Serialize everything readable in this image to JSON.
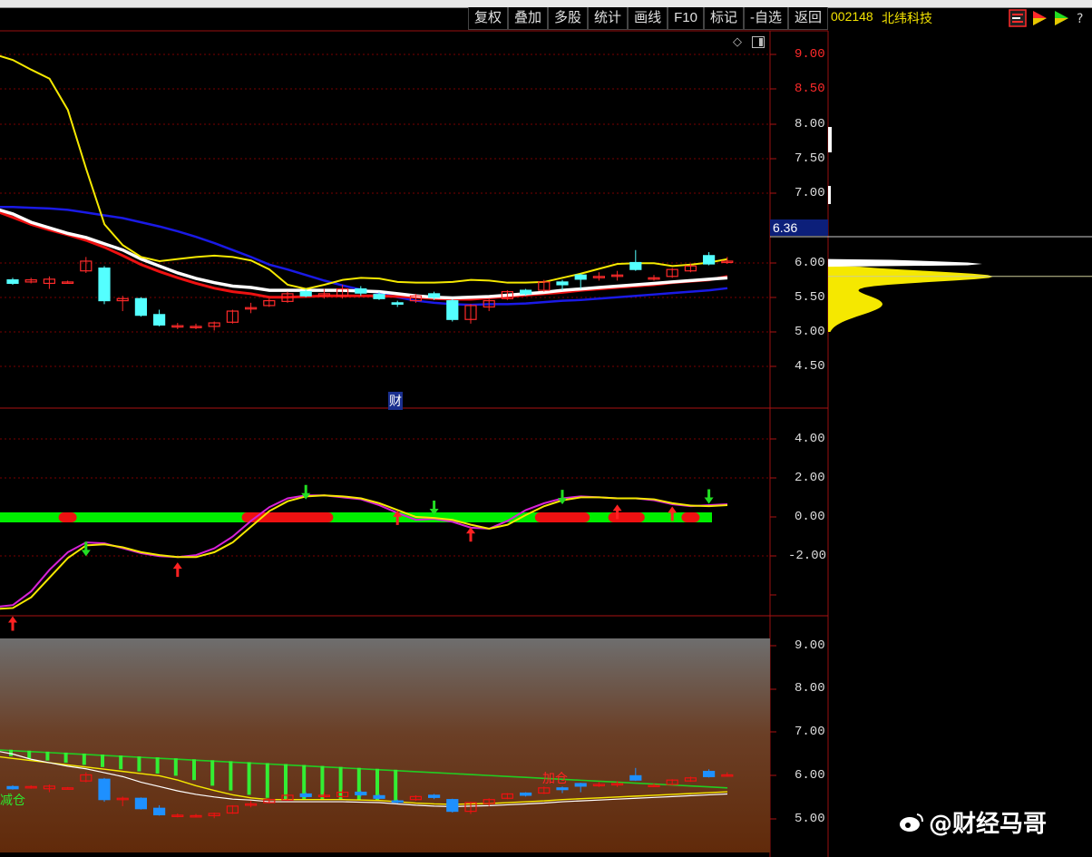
{
  "toolbar": {
    "buttons": [
      "复权",
      "叠加",
      "多股",
      "统计",
      "画线",
      "F10",
      "标记",
      "-自选",
      "返回"
    ]
  },
  "stock": {
    "code": "002148",
    "name": "北纬科技"
  },
  "main_panel": {
    "current_price": "6.36",
    "finance_marker": "财",
    "y_ticks": [
      "9.00",
      "8.50",
      "8.00",
      "7.50",
      "7.00",
      "6.00",
      "5.50",
      "5.00",
      "4.50"
    ]
  },
  "osc_panel": {
    "y_ticks": [
      "4.00",
      "2.00",
      "0.00",
      "-2.00"
    ]
  },
  "lower_panel": {
    "y_ticks": [
      "9.00",
      "8.00",
      "7.00",
      "6.00",
      "5.00"
    ],
    "signal_add": "加仓",
    "signal_reduce": "减仓"
  },
  "watermark": {
    "text": "@财经马哥"
  },
  "colors": {
    "up": "#ff2a2a",
    "down": "#54ffff",
    "ma_white": "#ffffff",
    "ma_yellow": "#f5e800",
    "ma_red": "#ee1111",
    "ma_blue": "#1a1ae6",
    "zero_band": "#00ee00",
    "grid": "#7a0000"
  },
  "chart_data": [
    {
      "type": "candlestick",
      "title": "",
      "ylim": [
        4.2,
        9.2
      ],
      "candles": [
        {
          "o": 5.75,
          "c": 5.7,
          "h": 5.78,
          "l": 5.68
        },
        {
          "o": 5.72,
          "c": 5.75,
          "h": 5.78,
          "l": 5.7
        },
        {
          "o": 5.7,
          "c": 5.76,
          "h": 5.8,
          "l": 5.62
        },
        {
          "o": 5.72,
          "c": 5.72,
          "h": 5.74,
          "l": 5.7
        },
        {
          "o": 5.88,
          "c": 6.02,
          "h": 6.08,
          "l": 5.85
        },
        {
          "o": 5.92,
          "c": 5.45,
          "h": 5.95,
          "l": 5.4
        },
        {
          "o": 5.45,
          "c": 5.48,
          "h": 5.52,
          "l": 5.3
        },
        {
          "o": 5.48,
          "c": 5.24,
          "h": 5.5,
          "l": 5.22
        },
        {
          "o": 5.25,
          "c": 5.1,
          "h": 5.32,
          "l": 5.08
        },
        {
          "o": 5.09,
          "c": 5.09,
          "h": 5.13,
          "l": 5.04
        },
        {
          "o": 5.08,
          "c": 5.08,
          "h": 5.12,
          "l": 5.04
        },
        {
          "o": 5.08,
          "c": 5.13,
          "h": 5.15,
          "l": 5.02
        },
        {
          "o": 5.14,
          "c": 5.3,
          "h": 5.32,
          "l": 5.12
        },
        {
          "o": 5.35,
          "c": 5.35,
          "h": 5.42,
          "l": 5.27
        },
        {
          "o": 5.38,
          "c": 5.45,
          "h": 5.48,
          "l": 5.36
        },
        {
          "o": 5.44,
          "c": 5.55,
          "h": 5.58,
          "l": 5.42
        },
        {
          "o": 5.58,
          "c": 5.52,
          "h": 5.62,
          "l": 5.5
        },
        {
          "o": 5.52,
          "c": 5.55,
          "h": 5.62,
          "l": 5.48
        },
        {
          "o": 5.52,
          "c": 5.62,
          "h": 5.68,
          "l": 5.48
        },
        {
          "o": 5.62,
          "c": 5.56,
          "h": 5.66,
          "l": 5.52
        },
        {
          "o": 5.54,
          "c": 5.48,
          "h": 5.58,
          "l": 5.46
        },
        {
          "o": 5.42,
          "c": 5.4,
          "h": 5.45,
          "l": 5.36
        },
        {
          "o": 5.45,
          "c": 5.52,
          "h": 5.55,
          "l": 5.42
        },
        {
          "o": 5.55,
          "c": 5.5,
          "h": 5.58,
          "l": 5.46
        },
        {
          "o": 5.45,
          "c": 5.18,
          "h": 5.47,
          "l": 5.15
        },
        {
          "o": 5.18,
          "c": 5.38,
          "h": 5.4,
          "l": 5.12
        },
        {
          "o": 5.36,
          "c": 5.45,
          "h": 5.48,
          "l": 5.3
        },
        {
          "o": 5.48,
          "c": 5.58,
          "h": 5.6,
          "l": 5.46
        },
        {
          "o": 5.6,
          "c": 5.55,
          "h": 5.62,
          "l": 5.52
        },
        {
          "o": 5.6,
          "c": 5.72,
          "h": 5.75,
          "l": 5.58
        },
        {
          "o": 5.72,
          "c": 5.68,
          "h": 5.75,
          "l": 5.6
        },
        {
          "o": 5.82,
          "c": 5.76,
          "h": 5.84,
          "l": 5.62
        },
        {
          "o": 5.8,
          "c": 5.8,
          "h": 5.86,
          "l": 5.74
        },
        {
          "o": 5.82,
          "c": 5.82,
          "h": 5.88,
          "l": 5.74
        },
        {
          "o": 6.0,
          "c": 5.9,
          "h": 6.18,
          "l": 5.88
        },
        {
          "o": 5.78,
          "c": 5.78,
          "h": 5.82,
          "l": 5.74
        },
        {
          "o": 5.8,
          "c": 5.9,
          "h": 5.92,
          "l": 5.78
        },
        {
          "o": 5.88,
          "c": 5.95,
          "h": 5.98,
          "l": 5.86
        },
        {
          "o": 6.1,
          "c": 5.98,
          "h": 6.15,
          "l": 5.96
        },
        {
          "o": 6.02,
          "c": 6.02,
          "h": 6.08,
          "l": 5.98
        }
      ],
      "ma": {
        "yellow": [
          9.0,
          8.92,
          8.78,
          8.65,
          8.2,
          7.35,
          6.55,
          6.25,
          6.08,
          6.02,
          6.05,
          6.08,
          6.1,
          6.08,
          6.03,
          5.9,
          5.68,
          5.62,
          5.68,
          5.75,
          5.78,
          5.77,
          5.72,
          5.71,
          5.71,
          5.72,
          5.75,
          5.74,
          5.71,
          5.71,
          5.72,
          5.78,
          5.84,
          5.91,
          5.98,
          5.99,
          5.99,
          5.95,
          5.97,
          6.0,
          6.05
        ],
        "white": [
          6.78,
          6.7,
          6.58,
          6.5,
          6.42,
          6.36,
          6.27,
          6.18,
          6.05,
          5.95,
          5.85,
          5.77,
          5.71,
          5.66,
          5.64,
          5.6,
          5.6,
          5.6,
          5.6,
          5.6,
          5.59,
          5.58,
          5.55,
          5.52,
          5.5,
          5.49,
          5.5,
          5.51,
          5.53,
          5.55,
          5.57,
          5.6,
          5.62,
          5.64,
          5.66,
          5.68,
          5.7,
          5.72,
          5.74,
          5.76,
          5.78
        ],
        "red": [
          6.75,
          6.65,
          6.55,
          6.47,
          6.4,
          6.32,
          6.22,
          6.1,
          5.97,
          5.87,
          5.78,
          5.7,
          5.63,
          5.58,
          5.55,
          5.5,
          5.5,
          5.51,
          5.52,
          5.52,
          5.52,
          5.52,
          5.51,
          5.5,
          5.48,
          5.47,
          5.47,
          5.49,
          5.51,
          5.53,
          5.55,
          5.57,
          5.6,
          5.62,
          5.64,
          5.66,
          5.68,
          5.71,
          5.73,
          5.75,
          5.8
        ],
        "blue": [
          6.8,
          6.8,
          6.79,
          6.78,
          6.76,
          6.72,
          6.68,
          6.64,
          6.58,
          6.52,
          6.45,
          6.37,
          6.28,
          6.18,
          6.08,
          5.97,
          5.9,
          5.82,
          5.74,
          5.67,
          5.61,
          5.56,
          5.5,
          5.45,
          5.42,
          5.4,
          5.39,
          5.4,
          5.4,
          5.41,
          5.43,
          5.45,
          5.46,
          5.48,
          5.5,
          5.52,
          5.54,
          5.56,
          5.58,
          5.6,
          5.63
        ]
      },
      "volume_profile_peak_price": 5.8
    },
    {
      "type": "line",
      "title": "",
      "ylim": [
        -4.8,
        5.0
      ],
      "series": [
        {
          "color": "#d622d6",
          "values": [
            -4.6,
            -4.5,
            -3.8,
            -2.7,
            -1.8,
            -1.3,
            -1.35,
            -1.6,
            -1.85,
            -2.0,
            -2.05,
            -1.95,
            -1.6,
            -1.0,
            -0.2,
            0.5,
            0.95,
            1.1,
            1.1,
            1.0,
            0.9,
            0.6,
            0.2,
            -0.15,
            -0.1,
            -0.25,
            -0.55,
            -0.6,
            -0.2,
            0.35,
            0.7,
            0.95,
            1.05,
            1.0,
            0.95,
            0.95,
            0.85,
            0.65,
            0.55,
            0.6,
            0.65
          ]
        },
        {
          "color": "#f5e800",
          "values": [
            -4.7,
            -4.65,
            -4.1,
            -3.1,
            -2.1,
            -1.45,
            -1.4,
            -1.55,
            -1.8,
            -1.95,
            -2.05,
            -2.05,
            -1.8,
            -1.3,
            -0.5,
            0.3,
            0.8,
            1.05,
            1.1,
            1.05,
            0.95,
            0.7,
            0.35,
            0.0,
            -0.05,
            -0.15,
            -0.4,
            -0.6,
            -0.4,
            0.1,
            0.55,
            0.85,
            1.0,
            1.0,
            0.95,
            0.95,
            0.9,
            0.7,
            0.58,
            0.55,
            0.6
          ]
        }
      ],
      "zero_band_red_segments": [
        [
          3,
          3
        ],
        [
          13,
          17
        ],
        [
          29,
          31
        ],
        [
          33,
          34
        ],
        [
          37,
          37
        ]
      ],
      "up_arrows": [
        0,
        9,
        21,
        25,
        33,
        36
      ],
      "down_arrows": [
        4,
        16,
        23,
        30,
        38
      ]
    }
  ]
}
